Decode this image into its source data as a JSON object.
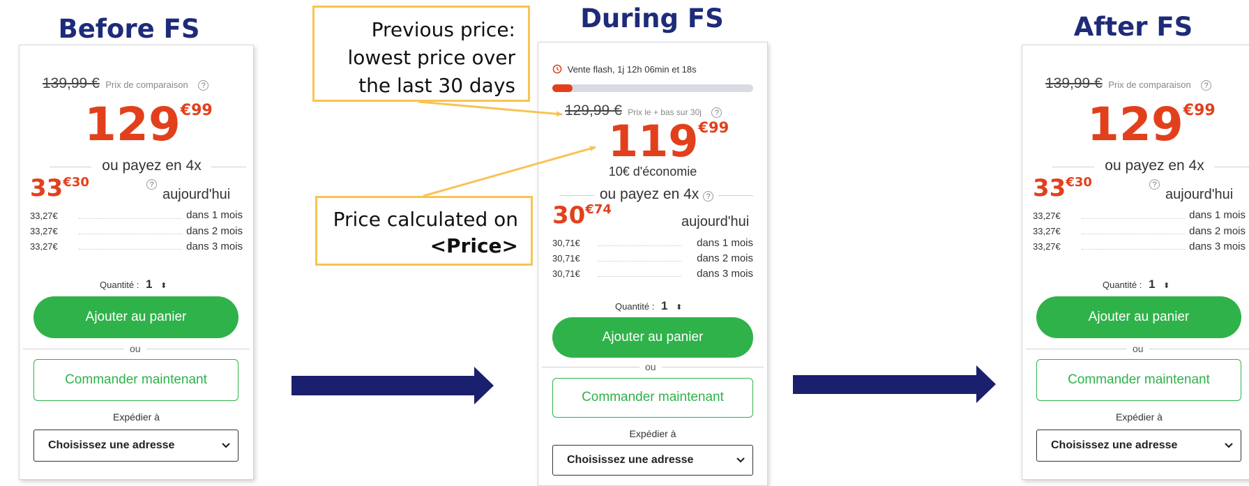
{
  "headings": {
    "before": "Before FS",
    "during": "During FS",
    "after": "After FS"
  },
  "callouts": {
    "previous_price": [
      "Previous price:",
      "lowest price over",
      "the last 30 days"
    ],
    "price_calculated_line1": "Price calculated on",
    "price_calculated_line2": "<Price>"
  },
  "cards": {
    "before": {
      "old_price": "139,99 €",
      "old_price_label": "Prix de comparaison",
      "help_icon": "?",
      "price_int": "129",
      "price_cents": "€99",
      "pay_in_4": "ou payez en 4x",
      "today_int": "33",
      "today_cents": "€30",
      "today_label": "aujourd'hui",
      "installments": [
        {
          "amount": "33,27€",
          "label": "dans 1 mois"
        },
        {
          "amount": "33,27€",
          "label": "dans 2 mois"
        },
        {
          "amount": "33,27€",
          "label": "dans 3 mois"
        }
      ],
      "quantity_label": "Quantité :",
      "quantity_value": "1",
      "quantity_arrows": "⬍",
      "add_to_cart": "Ajouter au panier",
      "or": "ou",
      "order_now": "Commander maintenant",
      "ship_to": "Expédier à",
      "address_select": "Choisissez une adresse"
    },
    "during": {
      "flash_label": "Vente flash, 1j 12h 06min et 18s",
      "flash_progress_fraction": 0.1,
      "old_price": "129,99 €",
      "old_price_label": "Prix le + bas sur 30j",
      "help_icon": "?",
      "price_int": "119",
      "price_cents": "€99",
      "savings": "10€ d'économie",
      "pay_in_4": "ou payez en 4x",
      "today_int": "30",
      "today_cents": "€74",
      "today_label": "aujourd'hui",
      "installments": [
        {
          "amount": "30,71€",
          "label": "dans 1 mois"
        },
        {
          "amount": "30,71€",
          "label": "dans 2 mois"
        },
        {
          "amount": "30,71€",
          "label": "dans 3 mois"
        }
      ],
      "quantity_label": "Quantité :",
      "quantity_value": "1",
      "quantity_arrows": "⬍",
      "add_to_cart": "Ajouter au panier",
      "or": "ou",
      "order_now": "Commander maintenant",
      "ship_to": "Expédier à",
      "address_select": "Choisissez une adresse"
    },
    "after": {
      "old_price": "139,99 €",
      "old_price_label": "Prix de comparaison",
      "help_icon": "?",
      "price_int": "129",
      "price_cents": "€99",
      "pay_in_4": "ou payez en 4x",
      "today_int": "33",
      "today_cents": "€30",
      "today_label": "aujourd'hui",
      "installments": [
        {
          "amount": "33,27€",
          "label": "dans 1 mois"
        },
        {
          "amount": "33,27€",
          "label": "dans 2 mois"
        },
        {
          "amount": "33,27€",
          "label": "dans 3 mois"
        }
      ],
      "quantity_label": "Quantité :",
      "quantity_value": "1",
      "quantity_arrows": "⬍",
      "add_to_cart": "Ajouter au panier",
      "or": "ou",
      "order_now": "Commander maintenant",
      "ship_to": "Expédier à",
      "address_select": "Choisissez une adresse"
    }
  },
  "colors": {
    "heading": "#1d2b78",
    "arrow": "#1a1f6e",
    "price_red": "#e2401c",
    "button_green": "#2fb24a",
    "callout_border": "#f7c453",
    "progress_track": "#d9dbe3"
  }
}
